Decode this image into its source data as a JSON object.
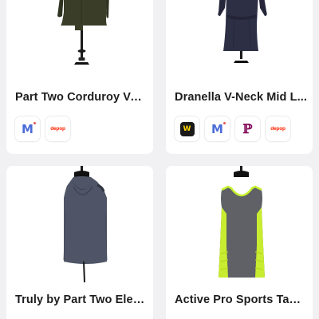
{
  "products": [
    {
      "title": "Part Two Corduroy Vel...",
      "marketplaces": [
        {
          "name": "mercari",
          "icon": "mercari-icon",
          "glyph": "M"
        },
        {
          "name": "depop",
          "icon": "depop-icon",
          "glyph": "depop"
        }
      ]
    },
    {
      "title": "Dranella V-Neck Mid L...",
      "marketplaces": [
        {
          "name": "whatnot",
          "icon": "whatnot-icon",
          "glyph": "W"
        },
        {
          "name": "mercari",
          "icon": "mercari-icon",
          "glyph": "M"
        },
        {
          "name": "poshmark",
          "icon": "poshmark-icon",
          "glyph": "P"
        },
        {
          "name": "depop",
          "icon": "depop-icon",
          "glyph": "depop"
        }
      ]
    },
    {
      "title": "Truly by Part Two Eleg...",
      "marketplaces": []
    },
    {
      "title": "Active Pro Sports Tank...",
      "marketplaces": []
    }
  ],
  "colors": {
    "background": "#f1f1f3",
    "card": "#ffffff",
    "mercari": "#4a6cd8",
    "depop": "#ff2300",
    "poshmark": "#7f0353",
    "whatnot": "#ffd400"
  }
}
